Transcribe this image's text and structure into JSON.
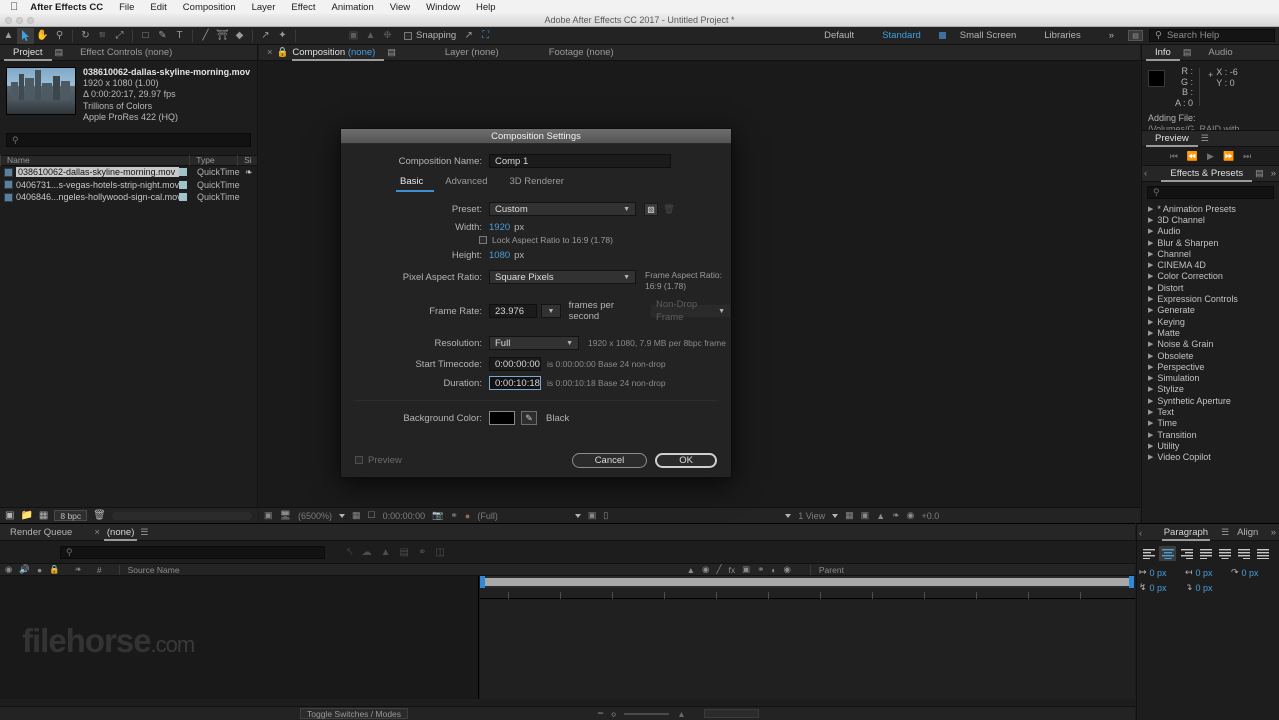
{
  "os_menu": {
    "apple": "apple-logo",
    "items": [
      "After Effects CC",
      "File",
      "Edit",
      "Composition",
      "Layer",
      "Effect",
      "Animation",
      "View",
      "Window",
      "Help"
    ]
  },
  "window": {
    "title": "Adobe After Effects CC 2017 - Untitled Project *"
  },
  "toolbar": {
    "snapping_label": "Snapping",
    "workspaces": [
      "Default",
      "Standard",
      "Small Screen",
      "Libraries"
    ],
    "active_workspace": "Standard",
    "overflow": "»",
    "search_placeholder": "Search Help"
  },
  "project_panel": {
    "tabs": [
      {
        "label": "Project",
        "active": true
      },
      {
        "label": "Effect Controls (none)",
        "active": false
      }
    ],
    "selected_asset": {
      "name": "038610062-dallas-skyline-morning.mov",
      "dimensions": "1920 x 1080 (1.00)",
      "duration": "Δ 0:00:20:17, 29.97 fps",
      "colors": "Trillions of Colors",
      "codec": "Apple ProRes 422 (HQ)"
    },
    "search_placeholder": "",
    "columns": [
      "Name",
      "Type",
      "Si"
    ],
    "rows": [
      {
        "name": "038610062-dallas-skyline-morning.mov",
        "type": "QuickTime",
        "selected": true
      },
      {
        "name": "0406731...s-vegas-hotels-strip-night.mov",
        "type": "QuickTime",
        "selected": false
      },
      {
        "name": "0406846...ngeles-hollywood-sign-cal.mov",
        "type": "QuickTime",
        "selected": false
      }
    ],
    "footer": {
      "bpc": "8 bpc"
    }
  },
  "comp_panel": {
    "tabs": [
      {
        "label": "Composition (none)",
        "active": true
      },
      {
        "label": "Layer (none)",
        "active": false
      },
      {
        "label": "Footage (none)",
        "active": false
      }
    ],
    "footer": {
      "zoom": "(6500%)",
      "timecode": "0:00:00:00",
      "resolution": "(Full)",
      "views": "1 View",
      "exposure": "+0.0"
    }
  },
  "info_panel": {
    "tabs": [
      {
        "label": "Info",
        "active": true
      },
      {
        "label": "Audio",
        "active": false
      }
    ],
    "r": "R :",
    "g": "G :",
    "b": "B :",
    "a": "A : 0",
    "x": "X : -6",
    "y": "Y : 0",
    "status_title": "Adding File:",
    "status_detail": "/Volumes/G_RAID with Thunderbolt"
  },
  "preview_panel": {
    "title": "Preview"
  },
  "effects_panel": {
    "title": "Effects & Presets",
    "search_placeholder": "",
    "categories": [
      "* Animation Presets",
      "3D Channel",
      "Audio",
      "Blur & Sharpen",
      "Channel",
      "CINEMA 4D",
      "Color Correction",
      "Distort",
      "Expression Controls",
      "Generate",
      "Keying",
      "Matte",
      "Noise & Grain",
      "Obsolete",
      "Perspective",
      "Simulation",
      "Stylize",
      "Synthetic Aperture",
      "Text",
      "Time",
      "Transition",
      "Utility",
      "Video Copilot"
    ]
  },
  "timeline_panel": {
    "tabs": [
      {
        "label": "Render Queue",
        "active": false
      },
      {
        "label": "(none)",
        "active": true
      }
    ],
    "search_placeholder": "",
    "columns": [
      "#",
      "Source Name",
      "Parent"
    ],
    "toggle_switches_label": "Toggle Switches / Modes",
    "watermark": "filehorse",
    "watermark_suffix": ".com"
  },
  "paragraph_panel": {
    "tabs": [
      {
        "label": "Paragraph",
        "active": true
      },
      {
        "label": "Align",
        "active": false
      }
    ],
    "indents": [
      {
        "name": "indent-left",
        "value": "0 px"
      },
      {
        "name": "indent-right",
        "value": "0 px"
      },
      {
        "name": "indent-first-line",
        "value": "0 px"
      },
      {
        "name": "space-before",
        "value": "0 px"
      },
      {
        "name": "space-after",
        "value": "0 px"
      }
    ]
  },
  "composition_settings": {
    "title": "Composition Settings",
    "composition_name_label": "Composition Name:",
    "composition_name_value": "Comp 1",
    "tabs": [
      {
        "label": "Basic",
        "active": true
      },
      {
        "label": "Advanced",
        "active": false
      },
      {
        "label": "3D Renderer",
        "active": false
      }
    ],
    "preset_label": "Preset:",
    "preset_value": "Custom",
    "width_label": "Width:",
    "width_value": "1920",
    "width_unit": "px",
    "height_label": "Height:",
    "height_value": "1080",
    "height_unit": "px",
    "lock_aspect_label": "Lock Aspect Ratio to 16:9 (1.78)",
    "lock_aspect_checked": false,
    "pixel_aspect_label": "Pixel Aspect Ratio:",
    "pixel_aspect_value": "Square Pixels",
    "frame_aspect_label": "Frame Aspect Ratio:",
    "frame_aspect_value": "16:9 (1.78)",
    "frame_rate_label": "Frame Rate:",
    "frame_rate_value": "23.976",
    "frame_rate_unit": "frames per second",
    "drop_frame_value": "Non-Drop Frame",
    "resolution_label": "Resolution:",
    "resolution_value": "Full",
    "resolution_hint": "1920 x 1080, 7.9 MB per 8bpc frame",
    "start_timecode_label": "Start Timecode:",
    "start_timecode_value": "0:00:00:00",
    "start_timecode_hint": "is 0:00:00:00 Base 24  non-drop",
    "duration_label": "Duration:",
    "duration_value": "0:00:10:18",
    "duration_hint": "is 0:00:10:18 Base 24  non-drop",
    "background_color_label": "Background Color:",
    "background_color_name": "Black",
    "background_color_hex": "#000000",
    "preview_label": "Preview",
    "preview_checked": false,
    "cancel_label": "Cancel",
    "ok_label": "OK",
    "accent_color": "#3f8fd0"
  }
}
